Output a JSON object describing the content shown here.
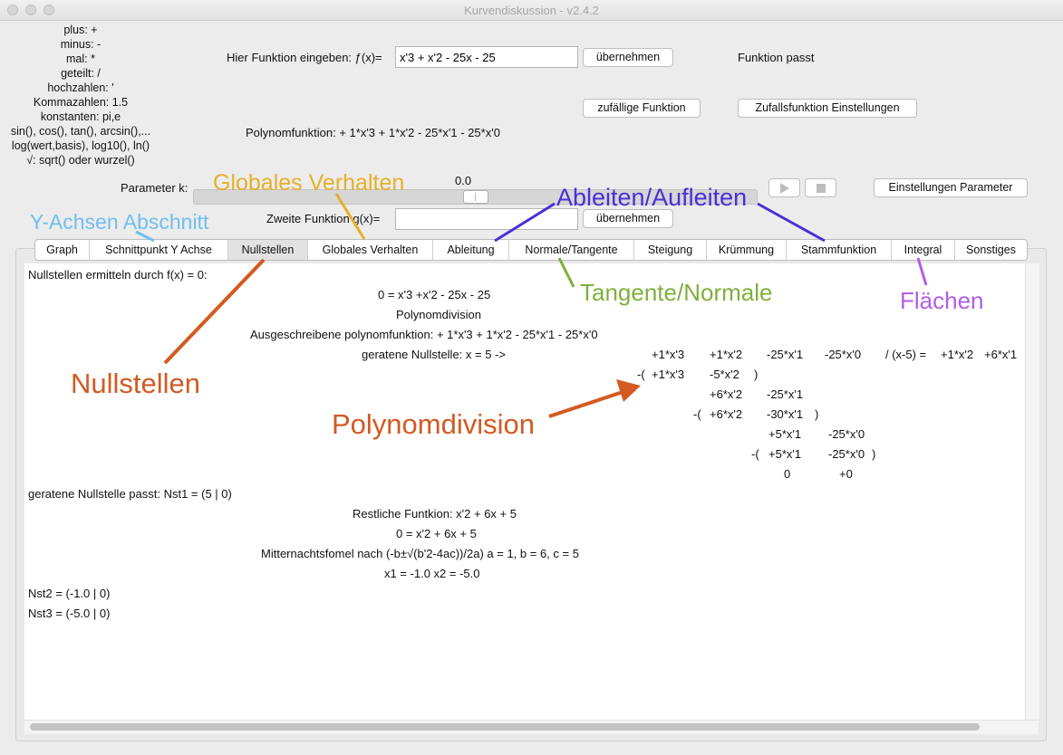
{
  "window": {
    "title": "Kurvendiskussion - v2.4.2"
  },
  "help_lines": [
    "plus: +",
    "minus: -",
    "mal: *",
    "geteilt: /",
    "hochzahlen: '",
    "Kommazahlen: 1.5",
    "konstanten: pi,e",
    "sin(), cos(), tan(), arcsin(),...",
    "log(wert,basis), log10(), ln()",
    "√: sqrt() oder wurzel()"
  ],
  "function_input": {
    "label": "Hier Funktion eingeben: ƒ(x)=",
    "value": "x'3 + x'2 - 25x - 25",
    "apply_label": "übernehmen",
    "status": "Funktion passt"
  },
  "random": {
    "random_label": "zufällige Funktion",
    "settings_label": "Zufallsfunktion Einstellungen"
  },
  "polynomial_display": "Polynomfunktion: + 1*x'3 + 1*x'2 - 25*x'1 - 25*x'0",
  "parameter": {
    "label": "Parameter k:",
    "value": "0.0",
    "position": 0.5,
    "settings_label": "Einstellungen Parameter"
  },
  "second_function": {
    "label": "Zweite Funktion g(x)=",
    "value": "",
    "apply_label": "übernehmen"
  },
  "tabs": [
    "Graph",
    "Schnittpunkt Y Achse",
    "Nullstellen",
    "Globales Verhalten",
    "Ableitung",
    "Normale/Tangente",
    "Steigung",
    "Krümmung",
    "Stammfunktion",
    "Integral",
    "Sonstiges"
  ],
  "selected_tab": "Nullstellen",
  "content": {
    "heading": "Nullstellen ermitteln durch f(x) = 0:",
    "equation": "0 = x'3 +x'2 - 25x - 25",
    "method": "Polynomdivision",
    "expanded": "Ausgeschreibene polynomfunktion: + 1*x'3 + 1*x'2 - 25*x'1 - 25*x'0",
    "guessed_root": "geratene Nullstelle: x = 5 ->",
    "division": {
      "row1": [
        "+1*x'3",
        "+1*x'2",
        "-25*x'1",
        "-25*x'0",
        "/ (x-5) =",
        "+1*x'2",
        "+6*x'1"
      ],
      "sub1": [
        "-(",
        "+1*x'3",
        "-5*x'2",
        ")"
      ],
      "rem1": [
        "+6*x'2",
        "-25*x'1"
      ],
      "sub2": [
        "-(",
        "+6*x'2",
        "-30*x'1",
        ")"
      ],
      "rem2": [
        "+5*x'1",
        "-25*x'0"
      ],
      "sub3": [
        "-(",
        "+5*x'1",
        "-25*x'0",
        ")"
      ],
      "rem3": [
        "0",
        "+0"
      ]
    },
    "root_ok": "geratene Nullstelle passt: Nst1 = (5 | 0)",
    "remaining": "Restliche Funtkion: x'2 + 6x + 5",
    "equation2": "0 = x'2 + 6x + 5",
    "formula": "Mitternachtsfomel nach (-b±√(b'2-4ac))/2a)  a = 1,  b = 6,  c = 5",
    "solutions": "x1 = -1.0  x2 = -5.0",
    "nst2": "Nst2 = (-1.0 | 0)",
    "nst3": "Nst3 = (-5.0 | 0)"
  },
  "annotations": {
    "y_achsen": {
      "text": "Y-Achsen Abschnitt",
      "color": "#6fbfee"
    },
    "global": {
      "text": "Globales Verhalten",
      "color": "#e5b02a"
    },
    "ableiten": {
      "text": "Ableiten/Aufleiten",
      "color": "#4b2fd6"
    },
    "tangente": {
      "text": "Tangente/Normale",
      "color": "#7fb03c"
    },
    "flaechen": {
      "text": "Flächen",
      "color": "#b05ee8"
    },
    "nullstellen": {
      "text": "Nullstellen",
      "color": "#d35a21"
    },
    "polynomdivision": {
      "text": "Polynomdivision",
      "color": "#d35a21"
    }
  }
}
